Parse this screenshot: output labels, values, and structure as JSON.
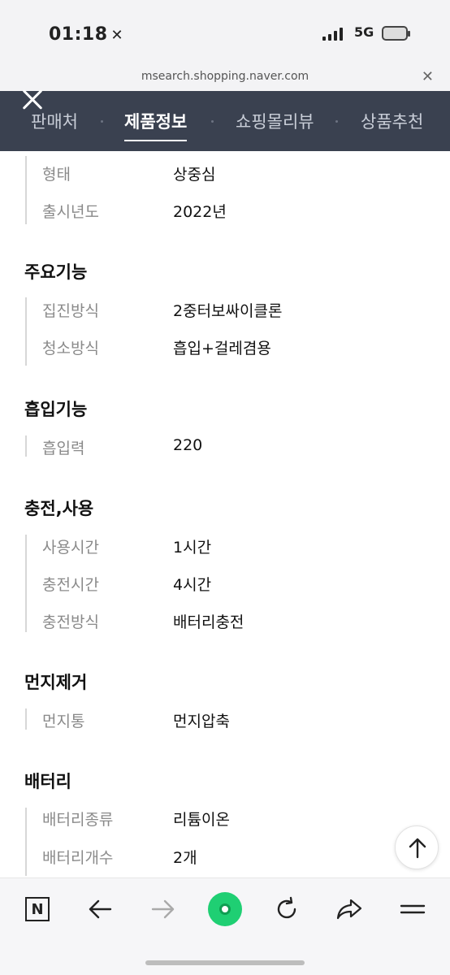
{
  "status_bar": {
    "time": "01:18",
    "network": "5G"
  },
  "browser": {
    "url": "msearch.shopping.naver.com"
  },
  "tabs": [
    {
      "label": "판매처"
    },
    {
      "label": "제품정보",
      "active": true
    },
    {
      "label": "쇼핑몰리뷰"
    },
    {
      "label": "상품추천"
    }
  ],
  "specs": {
    "basic": {
      "rows": [
        {
          "label": "형태",
          "value": "상중심"
        },
        {
          "label": "출시년도",
          "value": "2022년"
        }
      ]
    },
    "main_features": {
      "title": "주요기능",
      "rows": [
        {
          "label": "집진방식",
          "value": "2중터보싸이클론"
        },
        {
          "label": "청소방식",
          "value": "흡입+걸레겸용"
        }
      ]
    },
    "suction": {
      "title": "흡입기능",
      "rows": [
        {
          "label": "흡입력",
          "value": "220"
        }
      ]
    },
    "charging": {
      "title": "충전,사용",
      "rows": [
        {
          "label": "사용시간",
          "value": "1시간"
        },
        {
          "label": "충전시간",
          "value": "4시간"
        },
        {
          "label": "충전방식",
          "value": "배터리충전"
        }
      ]
    },
    "dust": {
      "title": "먼지제거",
      "rows": [
        {
          "label": "먼지통",
          "value": "먼지압축"
        }
      ]
    },
    "battery": {
      "title": "배터리",
      "rows": [
        {
          "label": "배터리종류",
          "value": "리튬이온"
        },
        {
          "label": "배터리개수",
          "value": "2개"
        }
      ]
    }
  },
  "toolbar": {
    "icons": [
      "naver-n-icon",
      "back-arrow-icon",
      "forward-arrow-icon",
      "green-dot-icon",
      "refresh-icon",
      "share-icon",
      "menu-icon"
    ]
  },
  "colors": {
    "tab_bar": "#3a4150",
    "green": "#1fcf73",
    "label": "#8a8a8a"
  }
}
